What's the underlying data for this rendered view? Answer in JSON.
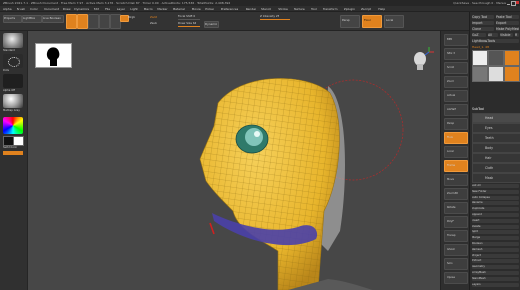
{
  "app": {
    "title": "ZBrush 2021.7.1 · ZBrush Document · Free Mem 7.97 · Active Mem 3,176 · Scratch Disk 87 · Timer 0.00 · ActivePoints: 175,536 · TotalPoints: 2,408,392",
    "right_items": [
      "QuickSave",
      "See-through 0",
      "Menus",
      "DefaultZScript"
    ]
  },
  "menubar": [
    "Alpha",
    "Brush",
    "Color",
    "Document",
    "Draw",
    "Dynamics",
    "Edit",
    "File",
    "Layer",
    "Light",
    "Macro",
    "Marker",
    "Material",
    "Movie",
    "Picker",
    "Preferences",
    "Render",
    "Stencil",
    "Stroke",
    "Texture",
    "Tool",
    "Transform",
    "Zplugin",
    "Zscript",
    "Help"
  ],
  "topshelf": {
    "labels": {
      "home": "Projects",
      "lightbox": "LightBox",
      "live": "Live Boolean",
      "edit": "Edit",
      "draw": "Draw",
      "move": "Move",
      "scale": "Scale",
      "rotate": "Rotate",
      "mrgb": "Mrgb",
      "rgb": "Rgb",
      "m": "M",
      "zadd": "Zadd",
      "zsub": "Zsub",
      "focal": "Focal Shift 0",
      "intensity": "Z Intensity 25",
      "drawsize": "Draw Size 64",
      "dynamic": "Dynamic",
      "persp": "Persp",
      "floor": "Floor",
      "local": "Local"
    }
  },
  "leftshelf": {
    "brush_label": "Standard",
    "stroke_label": "Dots",
    "alpha_label": "Alpha Off",
    "material_label": "MatCap Gray",
    "switch_label": "SwitchColor",
    "gradient_label": "Gradient"
  },
  "viewport": {
    "navigator_label": "Head preview"
  },
  "rightdock": {
    "buttons": [
      "BPR",
      "SPix 3",
      "Scroll",
      "Zoom",
      "Actual",
      "AAHalf",
      "Persp",
      "Floor",
      "Local",
      "Frame",
      "Move",
      "Zoom3D",
      "Rotate",
      "PolyF",
      "Transp",
      "Ghost",
      "Solo",
      "Xpose"
    ]
  },
  "tray": {
    "header": [
      "Copy Tool",
      "Paste Tool",
      "Import",
      "Export",
      "Clone",
      "Make PolyMesh3D",
      "GoZ",
      "All",
      "Visible",
      "R"
    ],
    "lightbox_tools": "Lightbox▸Tools",
    "tool_name": "Head_1. 48",
    "subtool_title": "SubTool",
    "subtools": [
      "Head",
      "Eyes",
      "Teeth",
      "Body",
      "Hair",
      "Cloth",
      "Mask"
    ],
    "lower": [
      "List All",
      "New Folder",
      "Auto Collapse",
      "Rename",
      "Duplicate",
      "Append",
      "Insert",
      "Delete",
      "Split",
      "Merge",
      "Boolean",
      "Remesh",
      "Project",
      "Extract",
      "Geometry",
      "ArrayMesh",
      "NanoMesh",
      "Layers"
    ]
  }
}
